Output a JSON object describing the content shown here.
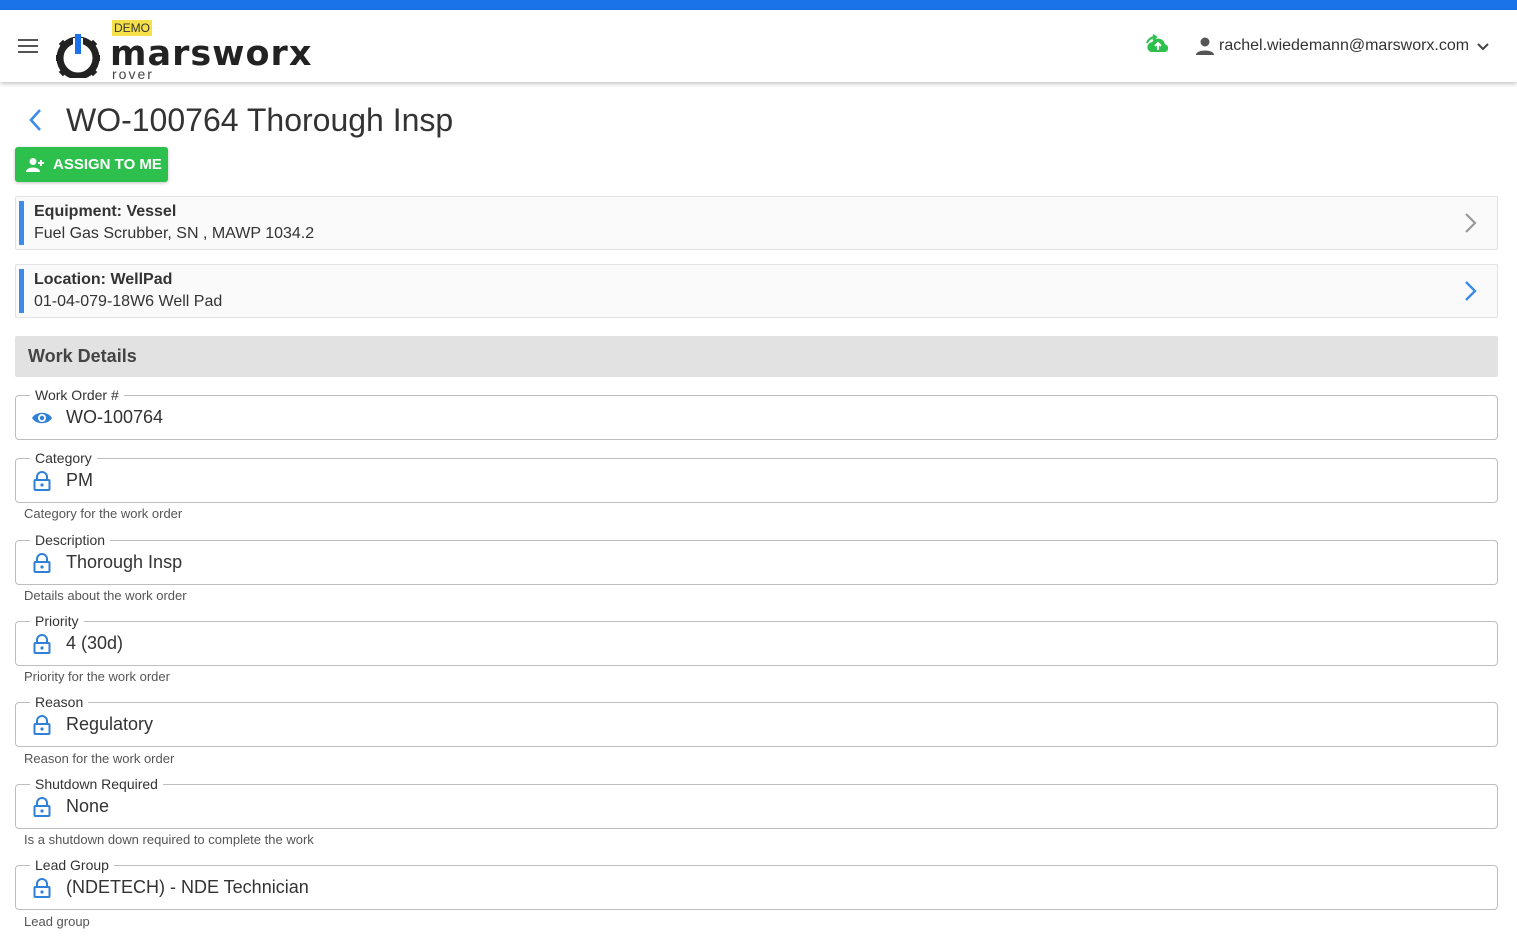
{
  "header": {
    "demo_badge": "DEMO",
    "brand": "marsworx",
    "brand_sub": "rover",
    "user_email": "rachel.wiedemann@marsworx.com"
  },
  "page": {
    "title": "WO-100764 Thorough Insp",
    "assign_label": "ASSIGN TO ME"
  },
  "equipment": {
    "title": "Equipment: Vessel",
    "subtitle": "Fuel Gas Scrubber, SN , MAWP 1034.2"
  },
  "location": {
    "title": "Location: WellPad",
    "subtitle": "01-04-079-18W6 Well Pad"
  },
  "section": {
    "title": "Work Details"
  },
  "fields": [
    {
      "label": "Work Order #",
      "value": "WO-100764",
      "hint": "",
      "icon": "eye-icon"
    },
    {
      "label": "Category",
      "value": "PM",
      "hint": "Category for the work order",
      "icon": "lock-icon"
    },
    {
      "label": "Description",
      "value": "Thorough Insp",
      "hint": "Details about the work order",
      "icon": "lock-icon"
    },
    {
      "label": "Priority",
      "value": "4 (30d)",
      "hint": "Priority for the work order",
      "icon": "lock-icon"
    },
    {
      "label": "Reason",
      "value": "Regulatory",
      "hint": "Reason for the work order",
      "icon": "lock-icon"
    },
    {
      "label": "Shutdown Required",
      "value": "None",
      "hint": "Is a shutdown down required to complete the work",
      "icon": "lock-icon"
    },
    {
      "label": "Lead Group",
      "value": "(NDETECH) - NDE Technician",
      "hint": "Lead group",
      "icon": "lock-icon"
    }
  ],
  "colors": {
    "accent": "#1a73e8",
    "assign_green": "#2ec04c",
    "card_accent": "#3d8be8"
  }
}
